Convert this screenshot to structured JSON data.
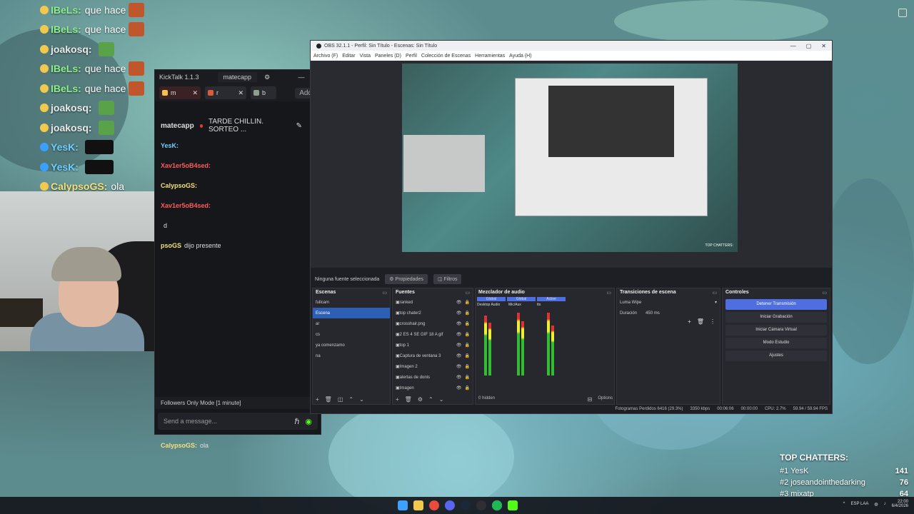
{
  "overlay_chat": [
    {
      "user": "IBeLs:",
      "msg": "que hace",
      "color": "#8ef08a"
    },
    {
      "user": "IBeLs:",
      "msg": "que hace",
      "color": "#8ef08a"
    },
    {
      "user": "joakosq:",
      "msg": "",
      "color": "#eaeaea"
    },
    {
      "user": "IBeLs:",
      "msg": "que hace",
      "color": "#8ef08a"
    },
    {
      "user": "IBeLs:",
      "msg": "que hace",
      "color": "#8ef08a"
    },
    {
      "user": "joakosq:",
      "msg": "",
      "color": "#eaeaea"
    },
    {
      "user": "joakosq:",
      "msg": "",
      "color": "#eaeaea"
    },
    {
      "user": "YesK:",
      "msg": "",
      "color": "#6fd0ff"
    },
    {
      "user": "YesK:",
      "msg": "",
      "color": "#6fd0ff"
    },
    {
      "user": "CalypsoGS:",
      "msg": "ola",
      "color": "#f4e07a"
    }
  ],
  "kicktalk": {
    "title": "KickTalk 1.1.3",
    "window_tab": "matecapp",
    "tabs": [
      "m",
      "r",
      "b"
    ],
    "add_label": "Add",
    "channel": "matecapp",
    "stream_title": "TARDE CHILLIN. SORTEO ...",
    "messages": [
      {
        "user": "YesK:",
        "text": "",
        "color": "#6fd0ff"
      },
      {
        "user": "Xav1er5oB4sed:",
        "text": "",
        "color": "#ff5a5a"
      },
      {
        "user": "CalypsoGS:",
        "text": "",
        "color": "#f4e07a"
      },
      {
        "user": "Xav1er5oB4sed:",
        "text": "",
        "color": "#ff5a5a"
      },
      {
        "user": "",
        "text": "d",
        "color": "#ddd"
      },
      {
        "user": "psoGS",
        "text": "dijo presente",
        "color": "#f4e07a"
      },
      {
        "user": "",
        "text": "",
        "color": "#ddd"
      },
      {
        "user": "",
        "text": "",
        "color": "#ddd"
      },
      {
        "user": "",
        "text": "",
        "color": "#ddd"
      },
      {
        "user": "",
        "text": "",
        "color": "#ddd"
      },
      {
        "user": "",
        "text": "",
        "color": "#ddd"
      },
      {
        "user": "",
        "text": "",
        "color": "#ddd"
      },
      {
        "user": "",
        "text": "",
        "color": "#ddd"
      },
      {
        "user": "YesK:",
        "text": "",
        "color": "#6fd0ff"
      },
      {
        "user": "YesK:",
        "text": "",
        "color": "#6fd0ff"
      },
      {
        "user": "CalypsoGS:",
        "text": "ola",
        "color": "#f4e07a"
      }
    ],
    "footer": "Followers Only Mode [1 minute]",
    "input_placeholder": "Send a message..."
  },
  "obs": {
    "title": "OBS 32.1.1 - Perfil: Sin Título - Escenas: Sin Título",
    "menu": [
      "Archivo (F)",
      "Editar",
      "Vista",
      "Paneles (D)",
      "Perfil",
      "Colección de Escenas",
      "Herramientas",
      "Ayuda (H)"
    ],
    "no_source": "Ninguna fuente seleccionada",
    "properties": "Propiedades",
    "filters": "Filtros",
    "scenes_title": "Escenas",
    "scenes": [
      "fullcam",
      "Escena",
      "ar",
      "cs",
      "ya comenzamo",
      "na"
    ],
    "sources_title": "Fuentes",
    "sources": [
      "ranked",
      "top chater2",
      "crosshair.png",
      "2 ES 4 SE GIF 18 A gif",
      "top 1",
      "Captura de ventana 3",
      "Imagen 2",
      "alertas de donis",
      "Imagen"
    ],
    "mixer_title": "Mezclador de audio",
    "mixer_channels": [
      "Desktop Audio",
      "Mic/Aux",
      "tts"
    ],
    "mixer_tags": [
      "Global",
      "Global",
      "Active"
    ],
    "hidden_label": "0 hidden",
    "options_label": "Options",
    "transitions_title": "Transiciones de escena",
    "transition": "Luma Wipe",
    "duration_label": "Duración",
    "duration_value": "450 ms",
    "controls_title": "Controles",
    "controls": [
      "Detener Transmisión",
      "Iniciar Grabación",
      "Iniciar Cámara Virtual",
      "Modo Estudio",
      "Ajustes"
    ],
    "status": {
      "dropped": "Fotogramas Perdidos 6416 (29.3%)",
      "bitrate": "3350 kbps",
      "stream_time": "00:06:06",
      "rec_time": "00:00:00",
      "cpu": "CPU: 2.7%",
      "fps": "59.94 / 59.94 FPS"
    }
  },
  "top_chatters": {
    "title": "TOP CHATTERS:",
    "rows": [
      {
        "rank": "#1 YesK",
        "count": "141"
      },
      {
        "rank": "#2 joseandointhedarking",
        "count": "76"
      },
      {
        "rank": "#3 mixatp",
        "count": "64"
      }
    ]
  },
  "taskbar": {
    "lang": "ESP LAA",
    "time": "22:00",
    "date": "6/4/2026"
  }
}
